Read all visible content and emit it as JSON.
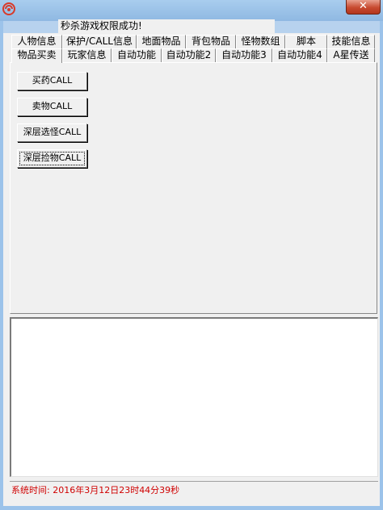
{
  "window": {
    "title_field": "秒杀游戏权限成功!",
    "close_glyph": "✕"
  },
  "tabs_row1": [
    {
      "label": "人物信息"
    },
    {
      "label": "保护/CALL信息"
    },
    {
      "label": "地面物品"
    },
    {
      "label": "背包物品"
    },
    {
      "label": "怪物数组"
    },
    {
      "label": "脚本"
    },
    {
      "label": "技能信息"
    }
  ],
  "tabs_row2": [
    {
      "label": "物品买卖",
      "active": true
    },
    {
      "label": "玩家信息"
    },
    {
      "label": "自动功能"
    },
    {
      "label": "自动功能2"
    },
    {
      "label": "自动功能3"
    },
    {
      "label": "自动功能4"
    },
    {
      "label": "A星传送"
    }
  ],
  "buttons": [
    {
      "label": "买药CALL"
    },
    {
      "label": "卖物CALL"
    },
    {
      "label": "深层选怪CALL"
    },
    {
      "label": "深层捡物CALL",
      "focused": true
    }
  ],
  "status": {
    "text": "系统时间: 2016年3月12日23时44分39秒"
  },
  "colors": {
    "status_text": "#d00000",
    "titlebar": "#9cc3ea",
    "close_button": "#c74a30"
  }
}
